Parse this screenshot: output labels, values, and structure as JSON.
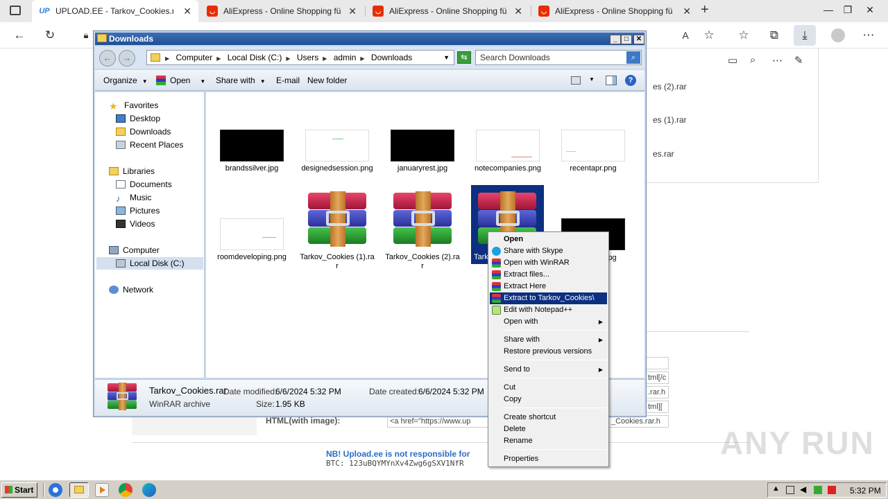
{
  "browser": {
    "tabs": [
      {
        "title": "UPLOAD.EE - Tarkov_Cookies.rar",
        "favicon": "UP",
        "active": true
      },
      {
        "title": "AliExpress - Online Shopping für",
        "active": false
      },
      {
        "title": "AliExpress - Online Shopping für",
        "active": false
      },
      {
        "title": "AliExpress - Online Shopping für",
        "active": false
      }
    ],
    "new_tab": "+",
    "reader_label": "A",
    "downloads_panel": {
      "items": [
        "es (2).rar",
        "es (1).rar",
        "es.rar"
      ]
    }
  },
  "page": {
    "html_with_image_label": "HTML(with image):",
    "html_snippet": "<a href=\"https://www.up",
    "html_snippet_tail": "_Cookies.rar.h",
    "field_tails": [
      "tml[/c",
      ".rar.h",
      "tml]["
    ],
    "nb_notice": "NB! Upload.ee is not responsible for",
    "btc": "BTC: 123uBQYMYnXv4Zwg6gSXV1NfR"
  },
  "explorer": {
    "title": "Downloads",
    "breadcrumb": [
      "Computer",
      "Local Disk (C:)",
      "Users",
      "admin",
      "Downloads"
    ],
    "search_placeholder": "Search Downloads",
    "commands": {
      "organize": "Organize",
      "open": "Open",
      "share_with": "Share with",
      "email": "E-mail",
      "new_folder": "New folder"
    },
    "nav": {
      "favorites": "Favorites",
      "desktop": "Desktop",
      "downloads": "Downloads",
      "recent_places": "Recent Places",
      "libraries": "Libraries",
      "documents": "Documents",
      "music": "Music",
      "pictures": "Pictures",
      "videos": "Videos",
      "computer": "Computer",
      "local_disk": "Local Disk (C:)",
      "network": "Network"
    },
    "files": {
      "f1": "brandssilver.jpg",
      "f2": "designedsession.png",
      "f3": "januaryrest.jpg",
      "f4": "notecompanies.png",
      "f5": "recentapr.png",
      "f6": "roomdeveloping.png",
      "f7": "Tarkov_Cookies (1).rar",
      "f8": "Tarkov_Cookies (2).rar",
      "f9": "Tark",
      "f10": "jpg"
    },
    "details": {
      "name": "Tarkov_Cookies.rar",
      "type": "WinRAR archive",
      "modified_label": "Date modified:",
      "modified": "6/6/2024 5:32 PM",
      "created_label": "Date created:",
      "created": "6/6/2024 5:32 PM",
      "size_label": "Size:",
      "size": "1.95 KB"
    }
  },
  "context_menu": {
    "open": "Open",
    "share_skype": "Share with Skype",
    "open_winrar": "Open with WinRAR",
    "extract_files": "Extract files...",
    "extract_here": "Extract Here",
    "extract_to": "Extract to Tarkov_Cookies\\",
    "edit_notepad": "Edit with Notepad++",
    "open_with": "Open with",
    "share_with": "Share with",
    "restore": "Restore previous versions",
    "send_to": "Send to",
    "cut": "Cut",
    "copy": "Copy",
    "create_shortcut": "Create shortcut",
    "delete": "Delete",
    "rename": "Rename",
    "properties": "Properties"
  },
  "taskbar": {
    "start": "Start",
    "clock": "5:32 PM"
  },
  "watermark": "ANY RUN",
  "colors": {
    "selection": "#0c2f80",
    "title_bar": "#1f4f96",
    "aliexpress": "#e62e04"
  }
}
